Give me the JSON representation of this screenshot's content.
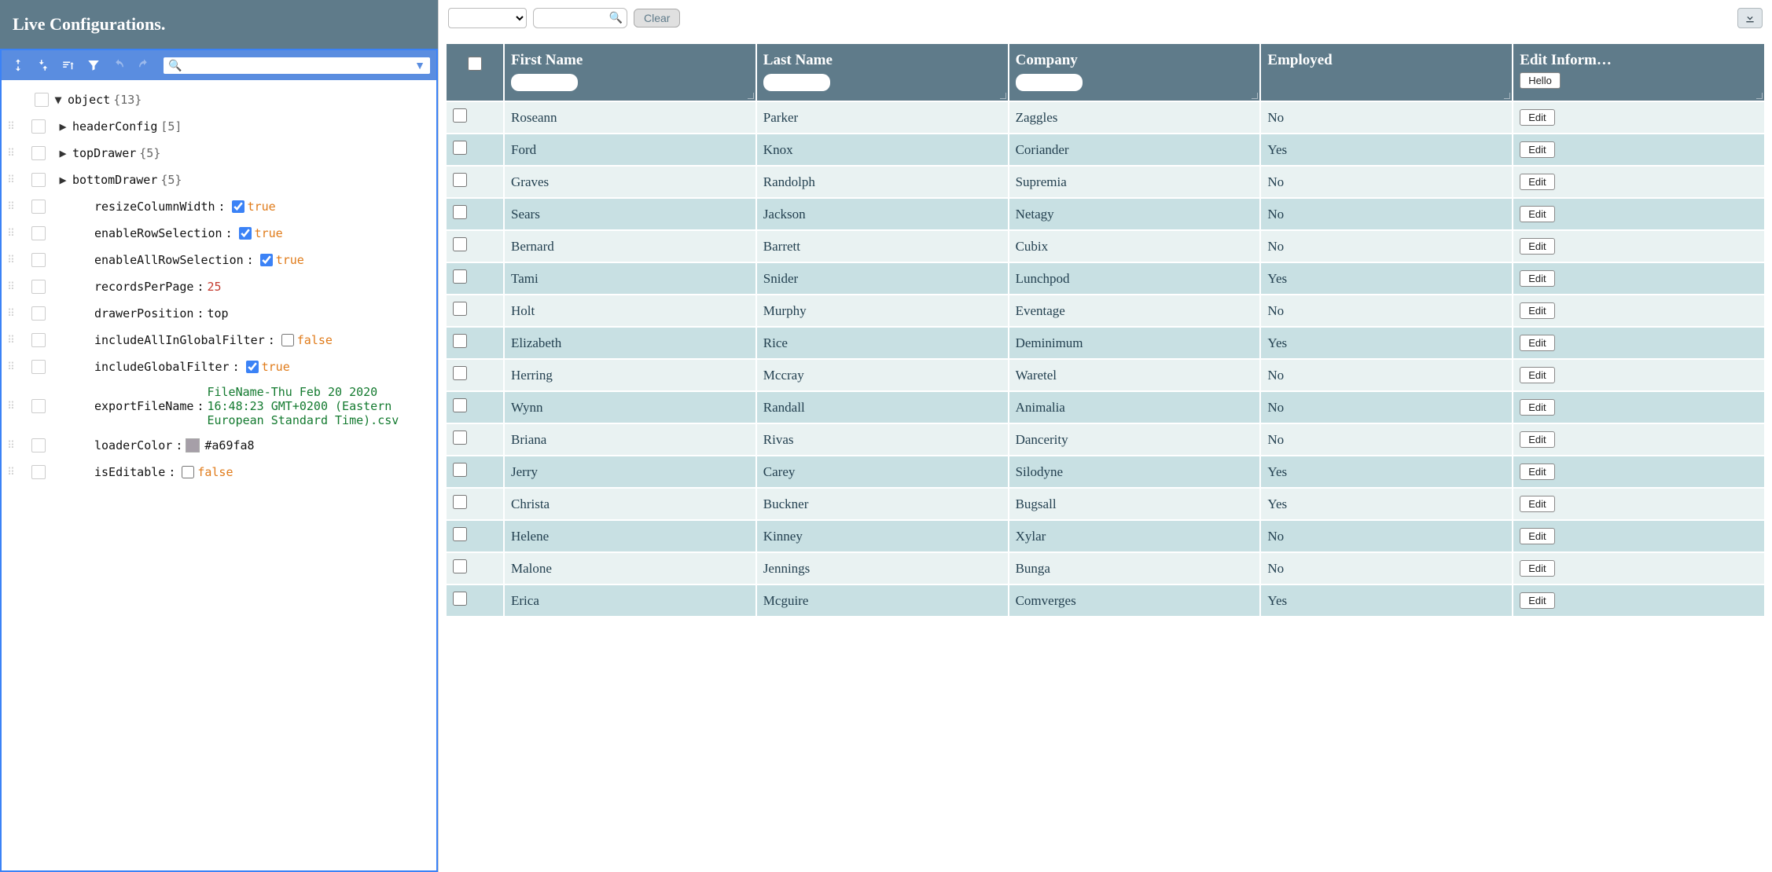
{
  "left": {
    "title": "Live Configurations.",
    "root_label": "object",
    "root_count": "{13}",
    "nodes": [
      {
        "key": "headerConfig",
        "count": "[5]",
        "expandable": true
      },
      {
        "key": "topDrawer",
        "count": "{5}",
        "expandable": true
      },
      {
        "key": "bottomDrawer",
        "count": "{5}",
        "expandable": true
      },
      {
        "key": "resizeColumnWidth",
        "type": "bool",
        "value": "true",
        "checked": true
      },
      {
        "key": "enableRowSelection",
        "type": "bool",
        "value": "true",
        "checked": true
      },
      {
        "key": "enableAllRowSelection",
        "type": "bool",
        "value": "true",
        "checked": true
      },
      {
        "key": "recordsPerPage",
        "type": "num",
        "value": "25"
      },
      {
        "key": "drawerPosition",
        "type": "plain",
        "value": "top"
      },
      {
        "key": "includeAllInGlobalFilter",
        "type": "bool",
        "value": "false",
        "checked": false
      },
      {
        "key": "includeGlobalFilter",
        "type": "bool",
        "value": "true",
        "checked": true
      },
      {
        "key": "exportFileName",
        "type": "string",
        "value": "FileName-Thu Feb 20 2020 16:48:23 GMT+0200 (Eastern European Standard Time).csv"
      },
      {
        "key": "loaderColor",
        "type": "color",
        "value": "#a69fa8"
      },
      {
        "key": "isEditable",
        "type": "bool",
        "value": "false",
        "checked": false
      }
    ]
  },
  "toolbar": {
    "clear_label": "Clear"
  },
  "table": {
    "hello_label": "Hello",
    "edit_label": "Edit",
    "headers": [
      "First Name",
      "Last Name",
      "Company",
      "Employed",
      "Edit Inform…"
    ],
    "rows": [
      {
        "first": "Roseann",
        "last": "Parker",
        "company": "Zaggles",
        "employed": "No"
      },
      {
        "first": "Ford",
        "last": "Knox",
        "company": "Coriander",
        "employed": "Yes"
      },
      {
        "first": "Graves",
        "last": "Randolph",
        "company": "Supremia",
        "employed": "No"
      },
      {
        "first": "Sears",
        "last": "Jackson",
        "company": "Netagy",
        "employed": "No"
      },
      {
        "first": "Bernard",
        "last": "Barrett",
        "company": "Cubix",
        "employed": "No"
      },
      {
        "first": "Tami",
        "last": "Snider",
        "company": "Lunchpod",
        "employed": "Yes"
      },
      {
        "first": "Holt",
        "last": "Murphy",
        "company": "Eventage",
        "employed": "No"
      },
      {
        "first": "Elizabeth",
        "last": "Rice",
        "company": "Deminimum",
        "employed": "Yes"
      },
      {
        "first": "Herring",
        "last": "Mccray",
        "company": "Waretel",
        "employed": "No"
      },
      {
        "first": "Wynn",
        "last": "Randall",
        "company": "Animalia",
        "employed": "No"
      },
      {
        "first": "Briana",
        "last": "Rivas",
        "company": "Dancerity",
        "employed": "No"
      },
      {
        "first": "Jerry",
        "last": "Carey",
        "company": "Silodyne",
        "employed": "Yes"
      },
      {
        "first": "Christa",
        "last": "Buckner",
        "company": "Bugsall",
        "employed": "Yes"
      },
      {
        "first": "Helene",
        "last": "Kinney",
        "company": "Xylar",
        "employed": "No"
      },
      {
        "first": "Malone",
        "last": "Jennings",
        "company": "Bunga",
        "employed": "No"
      },
      {
        "first": "Erica",
        "last": "Mcguire",
        "company": "Comverges",
        "employed": "Yes"
      }
    ]
  }
}
